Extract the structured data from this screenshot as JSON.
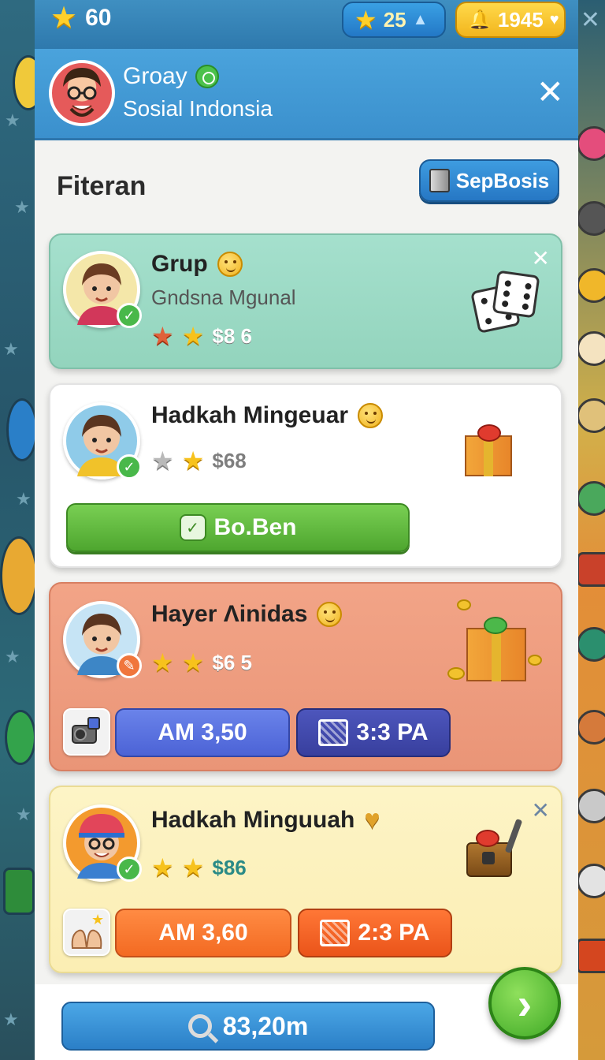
{
  "topbar": {
    "stars": "60",
    "currency_1": "25",
    "currency_2": "1945"
  },
  "header": {
    "name": "Groay",
    "subtitle": "Sosial Indonsia"
  },
  "section": {
    "title": "Fiteran",
    "button_label": "SepBosis"
  },
  "cards": [
    {
      "title": "Grup",
      "subtitle": "Gndsna Mgunal",
      "price": "$8 6"
    },
    {
      "title": "Hadkah Mingeuar",
      "price": "$68",
      "button_label": "Bo.Ben"
    },
    {
      "title": "Hayer Λinidas",
      "price": "$6 5",
      "button_1": "AM 3,50",
      "button_2": "3:3 PA"
    },
    {
      "title": "Hadkah Minguuah",
      "price": "$86",
      "button_1": "AM 3,60",
      "button_2": "2:3 PA"
    }
  ],
  "bottom": {
    "search_label": "83,20m"
  },
  "colors": {
    "accent_blue": "#3b90cd",
    "card_mint": "#a5e0cd",
    "card_salmon": "#f2a487",
    "card_cream": "#fdf4c6",
    "green_button": "#4ea62f"
  }
}
